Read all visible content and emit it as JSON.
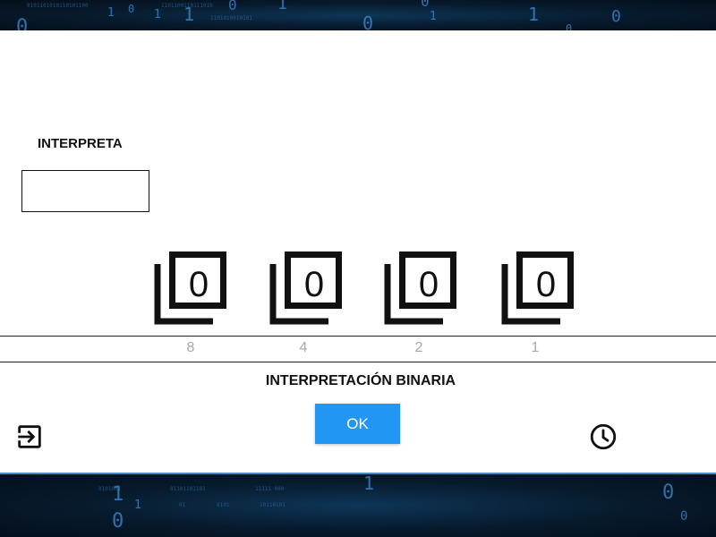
{
  "background": {
    "top_digits": [
      "0",
      "1",
      "0",
      "1",
      "1",
      "0",
      "1",
      "0",
      "0",
      "1",
      "1",
      "0",
      "0"
    ],
    "bottom_digits": [
      "1",
      "0",
      "1",
      "0",
      "1",
      "0"
    ]
  },
  "title": "INTERPRETA",
  "answer_input": {
    "value": ""
  },
  "cards": [
    {
      "value": "0",
      "weight": "8"
    },
    {
      "value": "0",
      "weight": "4"
    },
    {
      "value": "0",
      "weight": "2"
    },
    {
      "value": "0",
      "weight": "1"
    }
  ],
  "subtitle": "INTERPRETACIÓN BINARIA",
  "ok_button": {
    "label": "OK"
  },
  "icons": {
    "exit": "exit-to-app-icon",
    "clock": "clock-icon"
  },
  "colors": {
    "accent": "#2196f3",
    "weight_text": "#a7a7a7",
    "panel_border": "#4a87c6"
  }
}
